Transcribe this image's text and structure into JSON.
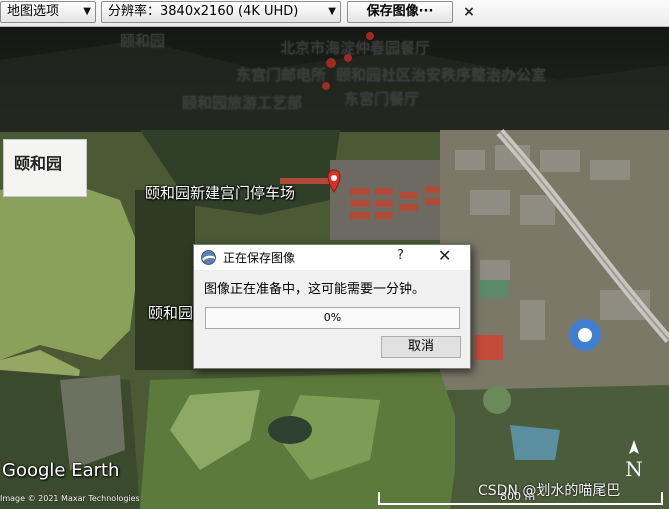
{
  "toolbar": {
    "map_options_label": "地图选项",
    "resolution_label": "分辨率：3840x2160 (4K UHD)",
    "save_image_label": "保存图像···",
    "close_symbol": "×"
  },
  "title_card": {
    "text": "颐和园"
  },
  "map_labels": {
    "yiheyuan_top": "颐和园",
    "haidian_restaurant": "北京市海淀仲春园餐厅",
    "east_gate_post": "东宫门邮电所",
    "management_office": "颐和园社区治安秩序整治办公室",
    "yiheyuan_travel": "颐和园旅游工艺部",
    "east_gate_restaurant": "东宫门餐厅",
    "new_gate_parking": "颐和园新建宫门停车场",
    "yiheyuan_left": "颐和园"
  },
  "dialog": {
    "title": "正在保存图像",
    "help_symbol": "?",
    "close_symbol": "✕",
    "message": "图像正在准备中，这可能需要一分钟。",
    "progress_value": 0,
    "progress_text": "0%",
    "cancel_label": "取消"
  },
  "footer": {
    "logo": "Google Earth",
    "imagery_credit": "Image © 2021 Maxar Technologies",
    "watermark": "CSDN @划水的喵尾巴",
    "scale_text": "800 m",
    "compass_letter": "N"
  },
  "colors": {
    "progress_green": "#06b025",
    "marker_red": "#d93025"
  },
  "icons": {
    "dropdown": "chevron-down-icon",
    "app_icon": "google-earth-globe-icon",
    "marker": "map-marker-icon"
  }
}
